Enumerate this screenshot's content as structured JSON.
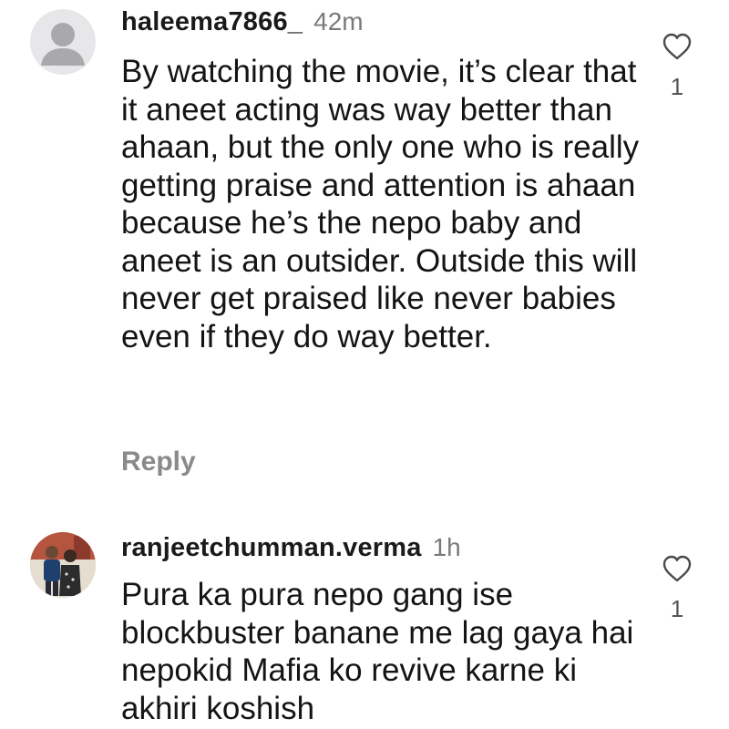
{
  "comments": [
    {
      "username": "haleema7866_",
      "time": "42m",
      "text": "By watching the movie, it’s clear that it aneet acting was way better than ahaan, but the only one who is really getting praise and attention is ahaan because he’s the nepo baby and aneet is an outsider. Outside this will never get praised like never babies even if they do way better.",
      "reply_label": "Reply",
      "like_count": "1",
      "avatar": "default-avatar-icon"
    },
    {
      "username": "ranjeetchumman.verma",
      "time": "1h",
      "text": "Pura ka pura nepo gang ise blockbuster banane me lag gaya hai nepokid Mafia ko revive karne ki akhiri koshish",
      "like_count": "1",
      "avatar": "profile-photo"
    }
  ],
  "colors": {
    "text": "#141414",
    "meta": "#7a7a7a",
    "reply": "#8a8a8a",
    "avatar_default_bg": "#e7e7e9",
    "avatar_default_fg": "#a9a9ad"
  }
}
